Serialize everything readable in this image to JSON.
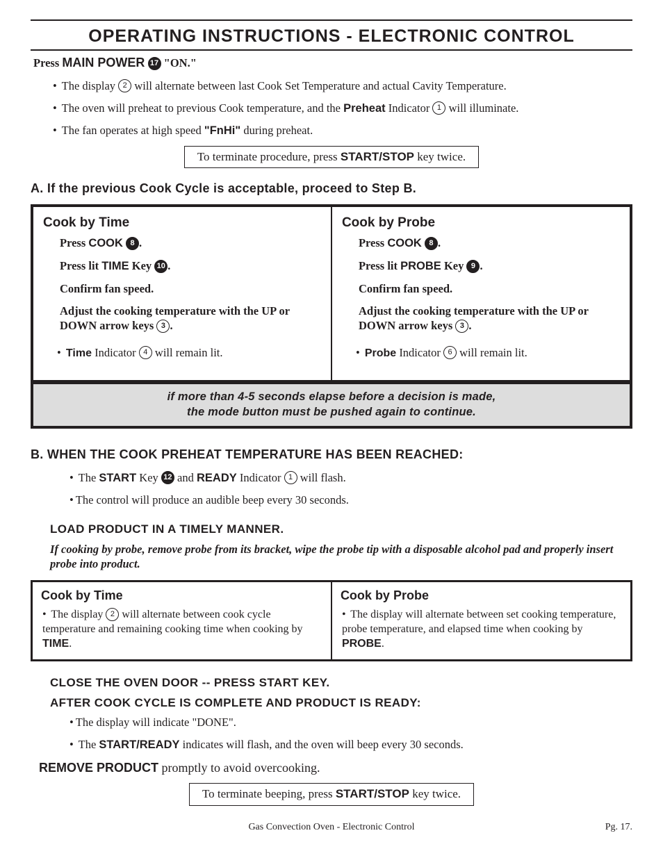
{
  "title": "OPERATING INSTRUCTIONS - ELECTRONIC CONTROL",
  "press_line": {
    "press": "Press ",
    "main_power": "MAIN POWER",
    "ref": "17",
    "on": "\"ON.\""
  },
  "intro_bullets": {
    "b1_a": "The display ",
    "b1_ref": "2",
    "b1_b": " will alternate between last Cook Set Temperature and actual Cavity Temperature.",
    "b2_a": "The oven will preheat to previous Cook temperature, and the ",
    "b2_bold": "Preheat",
    "b2_b": " Indicator ",
    "b2_ref": "1",
    "b2_c": " will illuminate.",
    "b3_a": "The fan operates at high speed ",
    "b3_bold": "\"FnHi\"",
    "b3_b": " during preheat."
  },
  "terminate1_a": "To terminate procedure, press ",
  "terminate1_bold": "START/STOP",
  "terminate1_b": " key twice.",
  "stepA": "A.  If the previous Cook Cycle is acceptable, proceed to Step B.",
  "box1": {
    "left": {
      "title": "Cook by Time",
      "s1_a": "Press ",
      "s1_bold": "COOK",
      "s1_ref": "8",
      "s1_dot": ".",
      "s2_a": "Press lit ",
      "s2_bold": "TIME",
      "s2_b": " Key ",
      "s2_ref": "10",
      "s2_dot": ".",
      "s3": "Confirm fan speed.",
      "s4_a": "Adjust the cooking temperature with the UP or DOWN arrow keys ",
      "s4_ref": "3",
      "s4_dot": ".",
      "b_a": "",
      "b_bold": "Time",
      "b_b": " Indicator ",
      "b_ref": "4",
      "b_c": " will remain lit."
    },
    "right": {
      "title": "Cook by Probe",
      "s1_a": "Press ",
      "s1_bold": "COOK",
      "s1_ref": "8",
      "s1_dot": ".",
      "s2_a": "Press lit ",
      "s2_bold": "PROBE",
      "s2_b": "  Key ",
      "s2_ref": "9",
      "s2_dot": ".",
      "s3": "Confirm fan speed.",
      "s4_a": "Adjust the cooking temperature with the UP or DOWN arrow keys ",
      "s4_ref": "3",
      "s4_dot": ".",
      "b_bold": "Probe",
      "b_b": " Indicator ",
      "b_ref": "6",
      "b_c": " will remain lit."
    }
  },
  "banner1": "if more than 4-5 seconds elapse before a decision is made,",
  "banner2": "the mode button must be pushed again to continue.",
  "stepB": "B.  WHEN THE COOK PREHEAT TEMPERATURE HAS BEEN REACHED:",
  "afterB": {
    "l1_a": "The ",
    "l1_bold1": "START",
    "l1_b": " Key ",
    "l1_ref1": "12",
    "l1_c": " and ",
    "l1_bold2": "READY",
    "l1_d": " Indicator ",
    "l1_ref2": "1",
    "l1_e": " will flash.",
    "l2": "The control will produce an audible beep every 30 seconds."
  },
  "load_h": "LOAD PRODUCT IN A TIMELY MANNER.",
  "ital_note": "If cooking by probe, remove probe from its bracket, wipe the probe tip with a disposable alcohol pad and properly insert probe into product.",
  "box2": {
    "left": {
      "title": "Cook by Time",
      "t_a": "The display ",
      "t_ref": "2",
      "t_b": " will alternate between cook cycle temperature and remaining cooking time when cooking by ",
      "t_bold": "TIME",
      "t_dot": "."
    },
    "right": {
      "title": "Cook by Probe",
      "t_a": "The display will alternate between set cooking temperature, probe temperature, and elapsed time when cooking by ",
      "t_bold": "PROBE",
      "t_dot": "."
    }
  },
  "close_h": "CLOSE THE OVEN DOOR -- PRESS START KEY.",
  "after_h": "AFTER COOK CYCLE IS COMPLETE AND PRODUCT IS READY:",
  "done_bullets": {
    "d1": "The display will indicate \"DONE\".",
    "d2_a": "The ",
    "d2_bold": "START/READY",
    "d2_b": " indicates will flash, and the oven will beep every 30 seconds."
  },
  "remove_a": "REMOVE PRODUCT",
  "remove_b": " promptly to avoid overcooking.",
  "terminate2_a": "To terminate beeping, press ",
  "terminate2_bold": "START/STOP",
  "terminate2_b": " key twice.",
  "footer_center": "Gas Convection Oven - Electronic Control",
  "footer_page": "Pg. 17."
}
